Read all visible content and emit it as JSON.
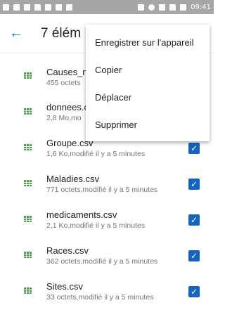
{
  "status_bar": {
    "time": "09:41",
    "left_icons": [
      "notification-icon",
      "person-icon",
      "image-icon",
      "message-icon",
      "usb-icon",
      "screenshot-icon",
      "download-icon"
    ],
    "right_icons": [
      "bluetooth-icon",
      "minus-circle-icon",
      "wifi-icon",
      "signal-icon",
      "battery-icon"
    ]
  },
  "appbar": {
    "back_icon": "arrow-left-icon",
    "title": "7 élém"
  },
  "files": [
    {
      "name": "Causes_m",
      "meta": "455 octets",
      "checked": false
    },
    {
      "name": "donnees.c",
      "meta": "2,8 Mo,mo",
      "checked": false
    },
    {
      "name": "Groupe.csv",
      "meta": "1,6 Ko,modifié il y a 5 minutes",
      "checked": true
    },
    {
      "name": "Maladies.csv",
      "meta": "771 octets,modifié il y a 5 minutes",
      "checked": true
    },
    {
      "name": "medicaments.csv",
      "meta": "2,1 Ko,modifié il y a 5 minutes",
      "checked": true
    },
    {
      "name": "Races.csv",
      "meta": "362 octets,modifié il y a 5 minutes",
      "checked": true
    },
    {
      "name": "Sites.csv",
      "meta": "33 octets,modifié il y a 5 minutes",
      "checked": true
    }
  ],
  "menu": {
    "items": [
      "Enregistrer sur l'appareil",
      "Copier",
      "Déplacer",
      "Supprimer"
    ]
  },
  "colors": {
    "status_bar": "#a6a6a6",
    "accent": "#1565c0",
    "file_icon": "#43a047"
  }
}
